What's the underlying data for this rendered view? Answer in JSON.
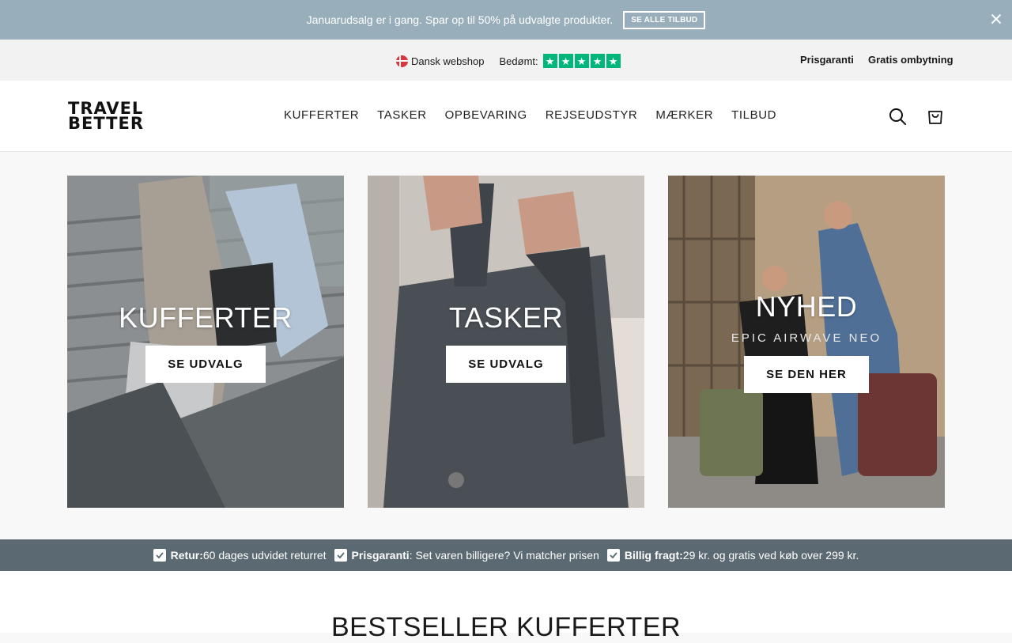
{
  "announcement": {
    "message": "Januarudsalg er i gang. Spar op til 50% på udvalgte produkter.",
    "button_label": "SE ALLE TILBUD"
  },
  "utility_bar": {
    "shop_label": "Dansk webshop",
    "rated_label": "Bedømt:",
    "rating_stars": 5,
    "links": [
      "Prisgaranti",
      "Gratis ombytning"
    ]
  },
  "header": {
    "logo_line1": "TRAVEL",
    "logo_line2": "BETTER",
    "nav": [
      "KUFFERTER",
      "TASKER",
      "OPBEVARING",
      "REJSEUDSTYR",
      "MÆRKER",
      "TILBUD"
    ]
  },
  "tiles": [
    {
      "title": "KUFFERTER",
      "subtitle": "",
      "cta": "SE UDVALG"
    },
    {
      "title": "TASKER",
      "subtitle": "",
      "cta": "SE UDVALG"
    },
    {
      "title": "NYHED",
      "subtitle": "EPIC AIRWAVE NEO",
      "cta": "SE DEN HER"
    }
  ],
  "usp": [
    {
      "bold": "Retur:",
      "text": " 60 dages udvidet returret"
    },
    {
      "bold": "Prisgaranti",
      "text": ": Set varen billigere? Vi matcher prisen"
    },
    {
      "bold": "Billig fragt:",
      "text": " 29 kr. og gratis ved køb over 299 kr."
    }
  ],
  "section": {
    "title": "BESTSELLER KUFFERTER"
  },
  "colors": {
    "announcement_bg": "#98aebb",
    "usp_bg": "#5b6a72",
    "trustpilot_green": "#00b67a",
    "flag_red": "#d9363e"
  }
}
